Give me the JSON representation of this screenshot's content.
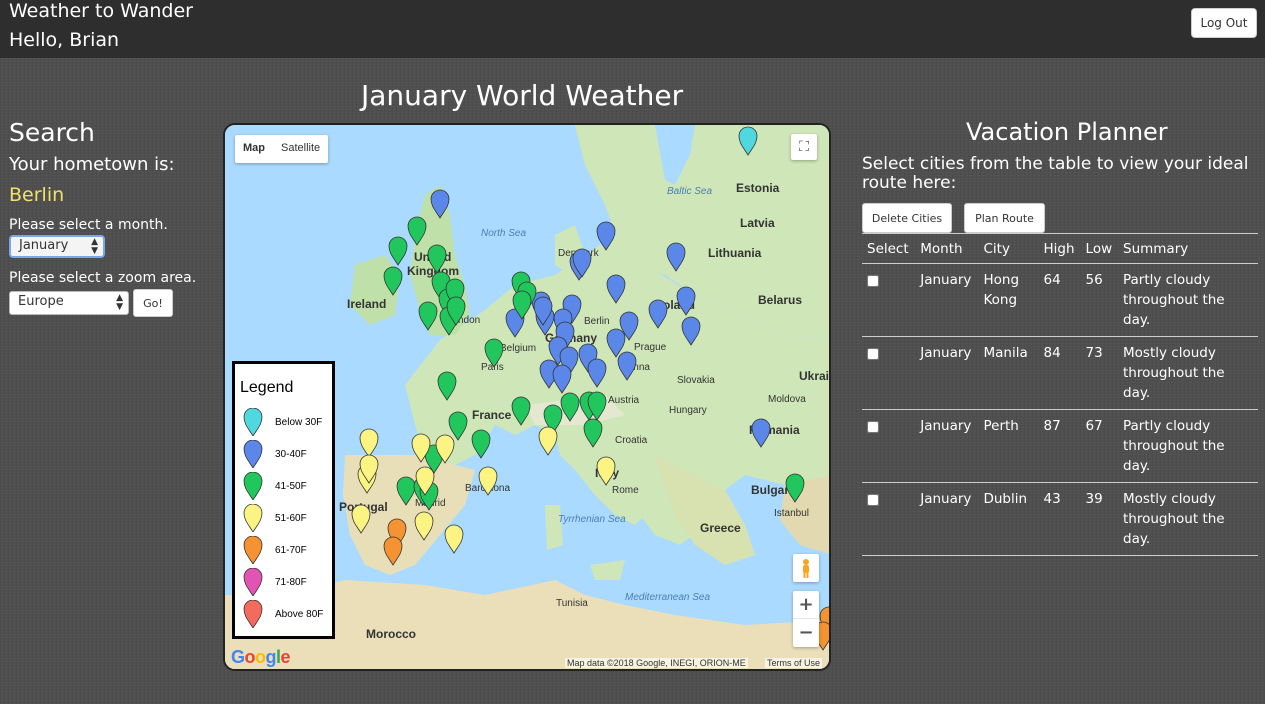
{
  "header": {
    "app_title": "Weather to Wander",
    "greeting": "Hello, Brian",
    "logout_label": "Log Out"
  },
  "search": {
    "title": "Search",
    "hometown_label": "Your hometown is:",
    "hometown_value": "Berlin",
    "month_label": "Please select a month.",
    "month_value": "January",
    "zoom_label": "Please select a zoom area.",
    "zoom_value": "Europe",
    "go_label": "Go!"
  },
  "map": {
    "title": "January World Weather",
    "type_buttons": [
      "Map",
      "Satellite"
    ],
    "active_type": "Map",
    "google_logo": "Google",
    "attribution": "Map data ©2018 Google, INEGI, ORION-ME",
    "terms": "Terms of Use",
    "places": {
      "baltic_sea": "Baltic Sea",
      "north_sea": "North Sea",
      "tyrrhenian_sea": "Tyrrhenian Sea",
      "mediterranean_sea": "Mediterranean Sea",
      "estonia": "Estonia",
      "latvia": "Latvia",
      "lithuania": "Lithuania",
      "denmark": "Denmark",
      "united_kingdom_1": "United",
      "united_kingdom_2": "Kingdom",
      "ireland": "Ireland",
      "belarus": "Belarus",
      "poland": "Poland",
      "berlin": "Berlin",
      "belgium": "Belgium",
      "germany": "Germany",
      "prague": "Prague",
      "paris": "Paris",
      "slovakia": "Slovakia",
      "ukraine": "Ukrai",
      "vienna": "Vienna",
      "austria": "Austria",
      "moldova": "Moldova",
      "hungary": "Hungary",
      "france": "France",
      "croatia": "Croatia",
      "romania": "Romania",
      "london": "ndon",
      "italy": "Italy",
      "rome": "Rome",
      "bulgaria": "Bulgaria",
      "portugal": "Portugal",
      "madrid": "Madrid",
      "barcelona": "Barcelona",
      "istanbul": "Istanbul",
      "greece": "Greece",
      "tunisia": "Tunisia",
      "morocco": "Morocco"
    },
    "legend": {
      "title": "Legend",
      "items": [
        {
          "label": "Below 30F",
          "color": "#4fd8e0"
        },
        {
          "label": "30-40F",
          "color": "#5b87e8"
        },
        {
          "label": "41-50F",
          "color": "#21c75c"
        },
        {
          "label": "51-60F",
          "color": "#fbf483"
        },
        {
          "label": "61-70F",
          "color": "#f59231"
        },
        {
          "label": "71-80F",
          "color": "#e254b3"
        },
        {
          "label": "Above 80F",
          "color": "#f36b5d"
        }
      ]
    }
  },
  "planner": {
    "title": "Vacation Planner",
    "instructions": "Select cities from the table to view your ideal route here:",
    "delete_label": "Delete Cities",
    "plan_label": "Plan Route",
    "columns": [
      "Select",
      "Month",
      "City",
      "High",
      "Low",
      "Summary"
    ],
    "rows": [
      {
        "month": "January",
        "city": "Hong Kong",
        "high": "64",
        "low": "56",
        "summary": "Partly cloudy throughout the day."
      },
      {
        "month": "January",
        "city": "Manila",
        "high": "84",
        "low": "73",
        "summary": "Mostly cloudy throughout the day."
      },
      {
        "month": "January",
        "city": "Perth",
        "high": "87",
        "low": "67",
        "summary": "Partly cloudy throughout the day."
      },
      {
        "month": "January",
        "city": "Dublin",
        "high": "43",
        "low": "39",
        "summary": "Mostly cloudy throughout the day."
      }
    ]
  }
}
